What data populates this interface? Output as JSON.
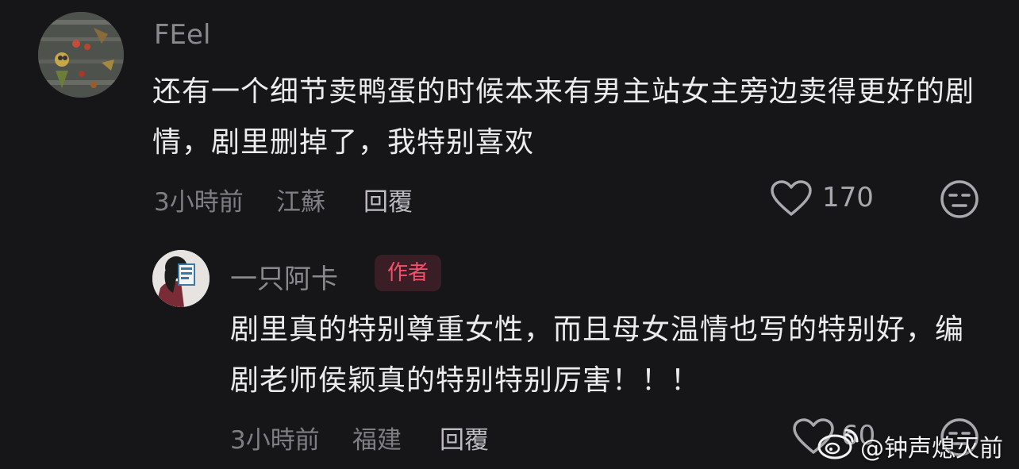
{
  "colors": {
    "background": "#161518",
    "username": "#8a898d",
    "content": "#ececee",
    "meta": "#7f7e82",
    "author_badge_bg": "#3a1e26",
    "author_badge_text": "#f5516d"
  },
  "comments": [
    {
      "username": "FEel",
      "text": "还有一个细节卖鸭蛋的时候本来有男主站女主旁边卖得更好的剧情，剧里删掉了，我特别喜欢",
      "time": "3小時前",
      "location": "江蘇",
      "reply_label": "回覆",
      "like_count": "170",
      "icons": [
        "heart-icon",
        "sleepy-face-icon"
      ]
    }
  ],
  "replies": [
    {
      "username": "一只阿卡",
      "badge": "作者",
      "text": "剧里真的特别尊重女性，而且母女温情也写的特别好，编剧老师侯颖真的特别特别厉害！！！",
      "time": "3小時前",
      "location": "福建",
      "reply_label": "回覆",
      "like_count": "60",
      "icons": [
        "heart-icon",
        "sleepy-face-icon"
      ]
    }
  ],
  "watermark": "@钟声熄灭前"
}
